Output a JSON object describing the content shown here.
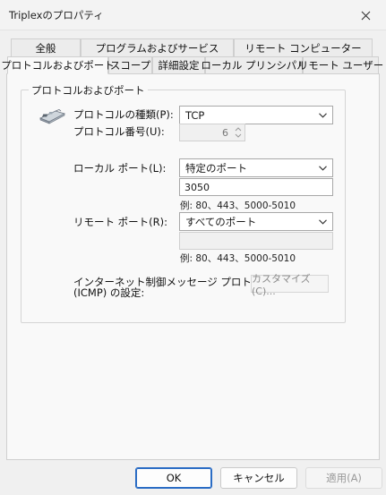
{
  "window": {
    "title": "Triplexのプロパティ"
  },
  "tabs_row1": [
    "全般",
    "プログラムおよびサービス",
    "リモート コンピューター"
  ],
  "tabs_row2": [
    "プロトコルおよびポート",
    "スコープ",
    "詳細設定",
    "ローカル プリンシパル",
    "リモート ユーザー"
  ],
  "active_tab": "プロトコルおよびポート",
  "group": {
    "title": "プロトコルおよびポート",
    "protocol_type_label": "プロトコルの種類(P):",
    "protocol_type_value": "TCP",
    "protocol_number_label": "プロトコル番号(U):",
    "protocol_number_value": "6",
    "local_port_label": "ローカル ポート(L):",
    "local_port_select": "特定のポート",
    "local_port_value": "3050",
    "local_port_hint": "例: 80、443、5000-5010",
    "remote_port_label": "リモート ポート(R):",
    "remote_port_select": "すべてのポート",
    "remote_port_value": "",
    "remote_port_hint": "例: 80、443、5000-5010",
    "icmp_label_line1": "インターネット制御メッセージ プロトコル",
    "icmp_label_line2": "(ICMP) の設定:",
    "customize_label": "カスタマイズ(C)..."
  },
  "buttons": {
    "ok": "OK",
    "cancel": "キャンセル",
    "apply": "適用(A)"
  },
  "icons": {
    "close": "close-icon",
    "network_card": "network-card-icon",
    "dropdown": "chevron-down-icon"
  }
}
